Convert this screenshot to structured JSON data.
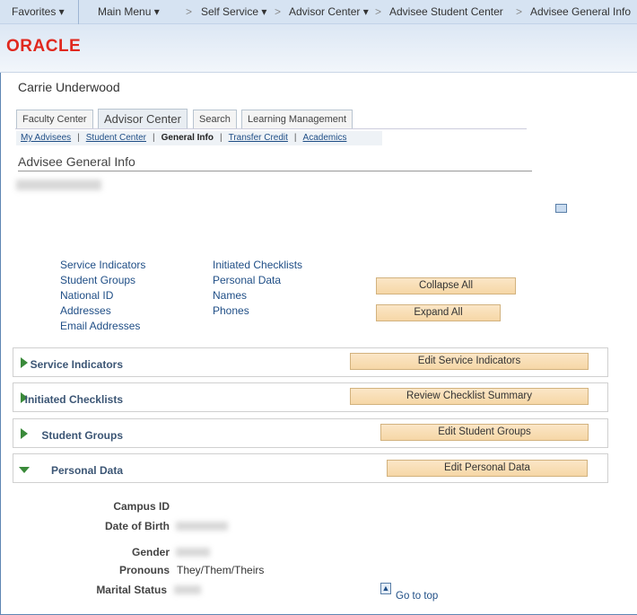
{
  "nav": {
    "favorites": "Favorites ▾",
    "main_menu": "Main Menu ▾",
    "crumbs": [
      "Self Service ▾",
      "Advisor Center ▾",
      "Advisee Student Center",
      "Advisee General Info"
    ],
    "sep": ">"
  },
  "logo": "ORACLE",
  "user_name": "Carrie Underwood",
  "tabs": [
    "Faculty Center",
    "Advisor Center",
    "Search",
    "Learning Management"
  ],
  "subnav": [
    "My Advisees",
    "Student Center",
    "General Info",
    "Transfer Credit",
    "Academics"
  ],
  "page_title": "Advisee General Info",
  "links_col1": [
    "Service Indicators",
    "Student Groups",
    "National ID",
    "Addresses",
    "Email Addresses"
  ],
  "links_col2": [
    "Initiated Checklists",
    "Personal Data",
    "Names",
    "Phones"
  ],
  "collapse_all": "Collapse All",
  "expand_all": "Expand All",
  "sections": [
    {
      "title": "Service Indicators",
      "button": "Edit Service Indicators",
      "expanded": false
    },
    {
      "title": "Initiated Checklists",
      "button": "Review Checklist Summary",
      "expanded": false
    },
    {
      "title": "Student Groups",
      "button": "Edit Student Groups",
      "expanded": false
    },
    {
      "title": "Personal Data",
      "button": "Edit Personal Data",
      "expanded": true
    }
  ],
  "personal": {
    "campus_id": "Campus ID",
    "dob": "Date of Birth",
    "gender": "Gender",
    "pronouns": "Pronouns",
    "pronouns_value": "They/Them/Theirs",
    "marital": "Marital Status"
  },
  "go_to_top": "Go to top",
  "colors": {
    "accent": "#1f4e86",
    "button": "#f6d7a6",
    "oracle": "#e0281e"
  }
}
